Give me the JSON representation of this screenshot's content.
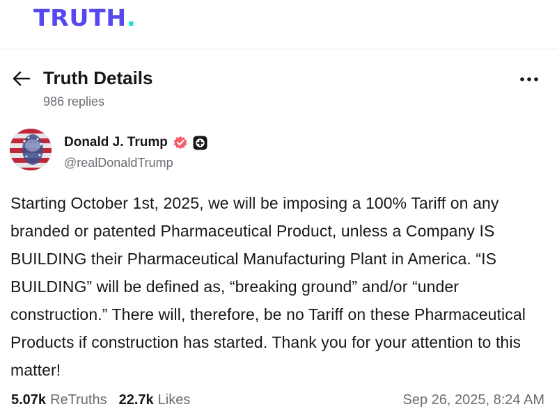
{
  "brand": {
    "logo_text": "TRUTH",
    "logo_dot": ".",
    "primary_color": "#5448ee",
    "accent_color": "#17e2c7"
  },
  "header": {
    "back_icon": "arrow-left-icon",
    "title": "Truth Details",
    "replies_label": "986 replies",
    "more_icon": "more-horizontal-icon"
  },
  "author": {
    "display_name": "Donald J. Trump",
    "handle": "@realDonaldTrump",
    "verified_icon": "verified-badge-icon",
    "verified_color": "#f45f6c",
    "plus_icon": "plus-badge-icon"
  },
  "post": {
    "text": "Starting October 1st, 2025, we will be imposing a 100% Tariff on any branded or patented Pharmaceutical Product, unless a Company IS BUILDING their Pharmaceutical Manufacturing Plant in America. “IS BUILDING” will be defined as, “breaking ground” and/or “under construction.” There will, therefore, be no Tariff on these Pharmaceutical Products if construction has started. Thank you for your attention to this matter!"
  },
  "stats": {
    "retruths_count": "5.07k",
    "retruths_label": "ReTruths",
    "likes_count": "22.7k",
    "likes_label": "Likes",
    "timestamp": "Sep 26, 2025, 8:24 AM"
  }
}
